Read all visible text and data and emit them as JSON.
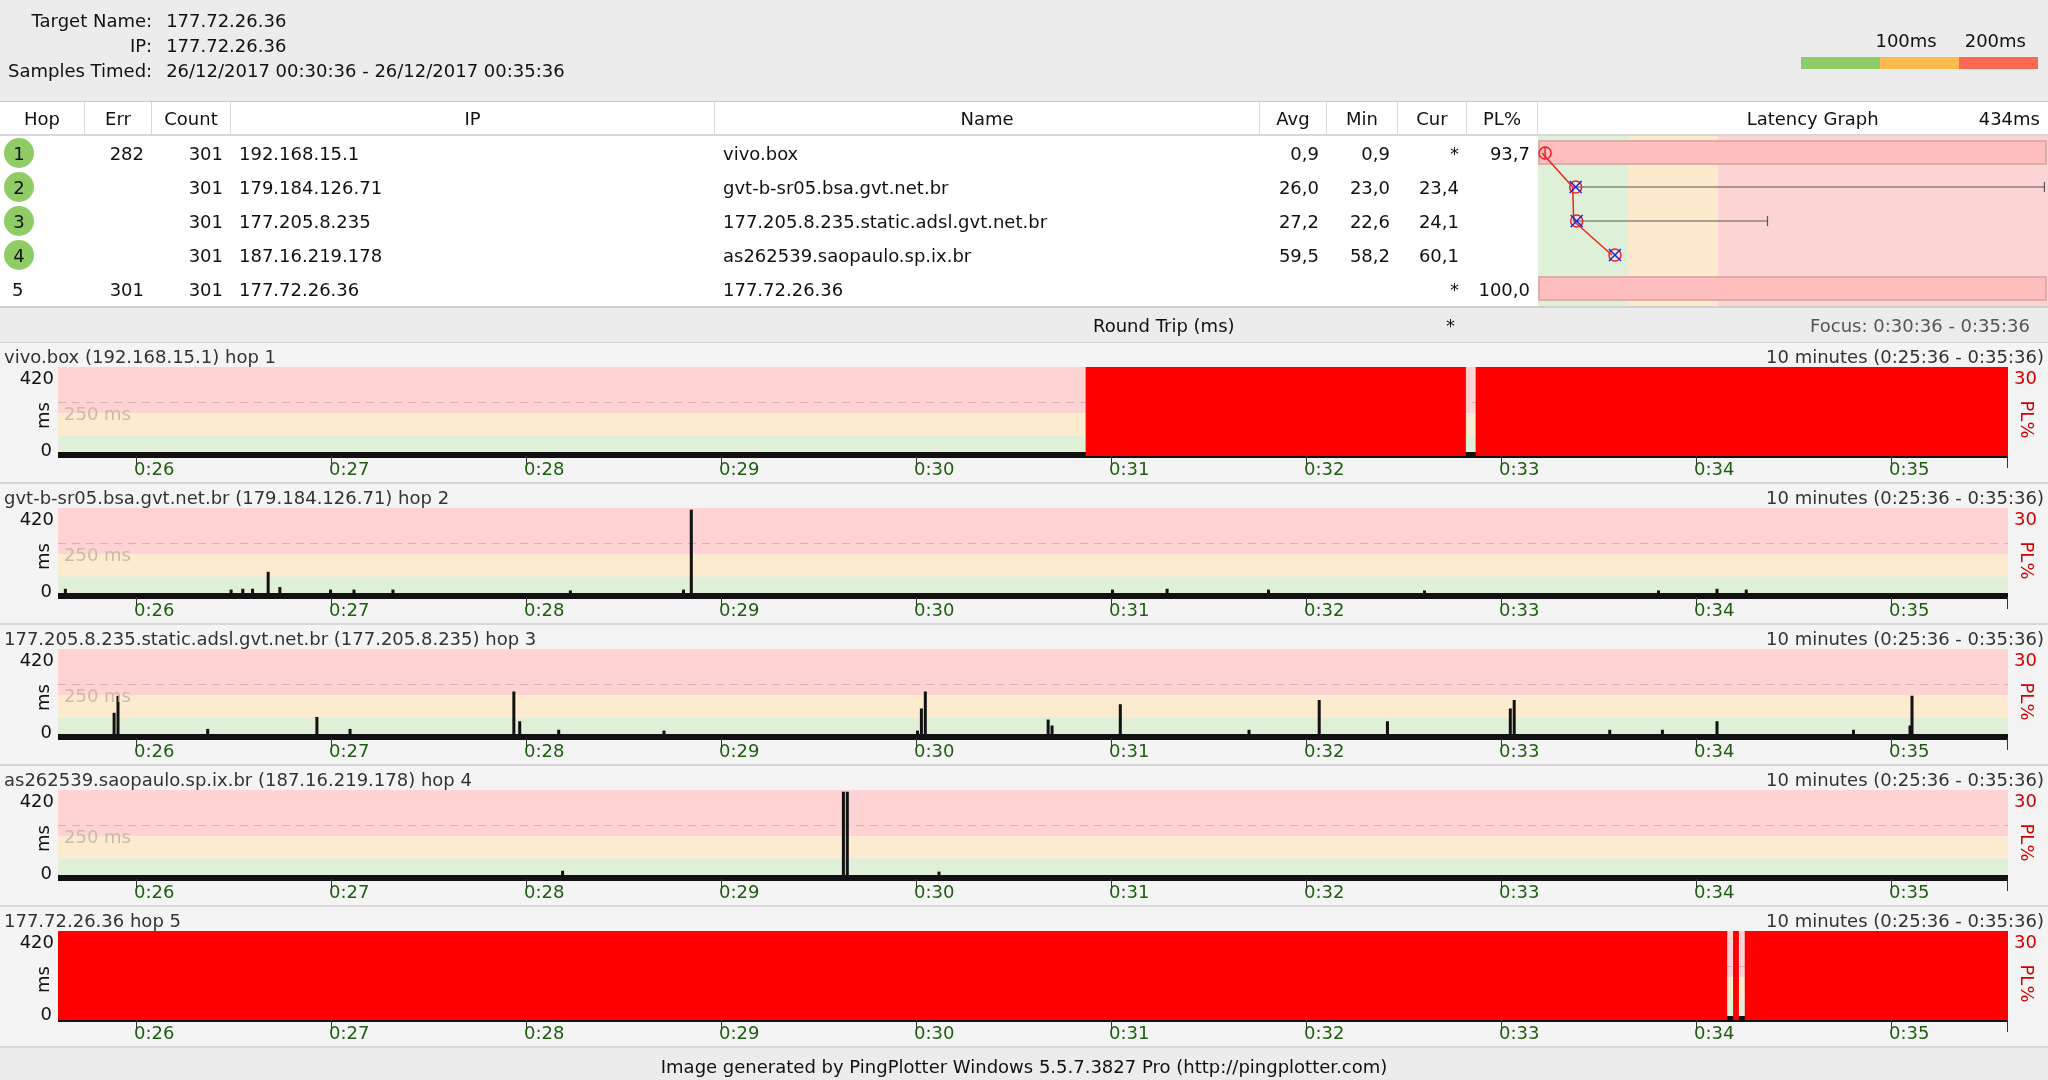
{
  "target": {
    "name_label": "Target Name:",
    "name": "177.72.26.36",
    "ip_label": "IP:",
    "ip": "177.72.26.36",
    "samples_label": "Samples Timed:",
    "samples": "26/12/2017 00:30:36 - 26/12/2017 00:35:36"
  },
  "legend": {
    "labels": [
      "100ms",
      "200ms"
    ]
  },
  "table": {
    "columns": [
      "Hop",
      "Err",
      "Count",
      "IP",
      "Name",
      "Avg",
      "Min",
      "Cur",
      "PL%"
    ],
    "latency_header": "Latency Graph",
    "latency_max": "434ms",
    "rows": [
      {
        "hop": "1",
        "responding": true,
        "loss_bar": true,
        "err": "282",
        "count": "301",
        "ip": "192.168.15.1",
        "name": "vivo.box",
        "avg": "0,9",
        "min": "0,9",
        "cur": "*",
        "pl": "93,7"
      },
      {
        "hop": "2",
        "responding": true,
        "loss_bar": false,
        "count": "301",
        "ip": "179.184.126.71",
        "name": "gvt-b-sr05.bsa.gvt.net.br",
        "avg": "26,0",
        "min": "23,0",
        "cur": "23,4"
      },
      {
        "hop": "3",
        "responding": true,
        "loss_bar": false,
        "count": "301",
        "ip": "177.205.8.235",
        "name": "177.205.8.235.static.adsl.gvt.net.br",
        "avg": "27,2",
        "min": "22,6",
        "cur": "24,1"
      },
      {
        "hop": "4",
        "responding": true,
        "loss_bar": false,
        "count": "301",
        "ip": "187.16.219.178",
        "name": "as262539.saopaulo.sp.ix.br",
        "avg": "59,5",
        "min": "58,2",
        "cur": "60,1"
      },
      {
        "hop": "5",
        "responding": false,
        "loss_bar": true,
        "err": "301",
        "count": "301",
        "ip": "177.72.26.36",
        "name": "177.72.26.36",
        "cur": "*",
        "pl": "100,0"
      }
    ],
    "summary": {
      "label": "Round Trip (ms)",
      "cur": "*",
      "focus": "Focus: 0:30:36 - 0:35:36"
    }
  },
  "graphs": [
    {
      "title": "vivo.box (192.168.15.1) hop 1",
      "range": "10 minutes (0:25:36 - 0:35:36)",
      "y_max": "420",
      "y_min": "0",
      "y_unit": "ms",
      "threshold": "250 ms",
      "pl_max": "30",
      "pl_unit": "PL%",
      "x_labels": [
        "0:26",
        "0:27",
        "0:28",
        "0:29",
        "0:30",
        "0:31",
        "0:32",
        "0:33",
        "0:34",
        "0:35"
      ]
    },
    {
      "title": "gvt-b-sr05.bsa.gvt.net.br (179.184.126.71) hop 2",
      "range": "10 minutes (0:25:36 - 0:35:36)",
      "y_max": "420",
      "y_min": "0",
      "y_unit": "ms",
      "threshold": "250 ms",
      "pl_max": "30",
      "pl_unit": "PL%",
      "x_labels": [
        "0:26",
        "0:27",
        "0:28",
        "0:29",
        "0:30",
        "0:31",
        "0:32",
        "0:33",
        "0:34",
        "0:35"
      ]
    },
    {
      "title": "177.205.8.235.static.adsl.gvt.net.br (177.205.8.235) hop 3",
      "range": "10 minutes (0:25:36 - 0:35:36)",
      "y_max": "420",
      "y_min": "0",
      "y_unit": "ms",
      "threshold": "250 ms",
      "pl_max": "30",
      "pl_unit": "PL%",
      "x_labels": [
        "0:26",
        "0:27",
        "0:28",
        "0:29",
        "0:30",
        "0:31",
        "0:32",
        "0:33",
        "0:34",
        "0:35"
      ]
    },
    {
      "title": "as262539.saopaulo.sp.ix.br (187.16.219.178) hop 4",
      "range": "10 minutes (0:25:36 - 0:35:36)",
      "y_max": "420",
      "y_min": "0",
      "y_unit": "ms",
      "threshold": "250 ms",
      "pl_max": "30",
      "pl_unit": "PL%",
      "x_labels": [
        "0:26",
        "0:27",
        "0:28",
        "0:29",
        "0:30",
        "0:31",
        "0:32",
        "0:33",
        "0:34",
        "0:35"
      ]
    },
    {
      "title": "177.72.26.36 hop 5",
      "range": "10 minutes (0:25:36 - 0:35:36)",
      "y_max": "420",
      "y_min": "0",
      "y_unit": "ms",
      "pl_max": "30",
      "pl_unit": "PL%",
      "x_labels": [
        "0:26",
        "0:27",
        "0:28",
        "0:29",
        "0:30",
        "0:31",
        "0:32",
        "0:33",
        "0:34",
        "0:35"
      ]
    }
  ],
  "footer": "Image generated by PingPlotter Windows 5.5.7.3827 Pro (http://pingplotter.com)"
}
